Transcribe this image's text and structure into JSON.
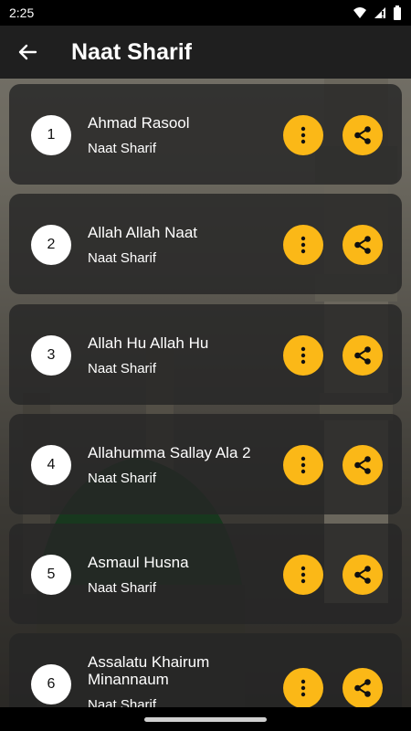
{
  "status_bar": {
    "time": "2:25"
  },
  "app_bar": {
    "title": "Naat Sharif",
    "back_icon": "arrow-left-icon"
  },
  "items": [
    {
      "number": "1",
      "title": "Ahmad Rasool",
      "subtitle": "Naat Sharif"
    },
    {
      "number": "2",
      "title": "Allah Allah Naat",
      "subtitle": "Naat Sharif"
    },
    {
      "number": "3",
      "title": "Allah Hu Allah Hu",
      "subtitle": "Naat Sharif"
    },
    {
      "number": "4",
      "title": "Allahumma Sallay Ala 2",
      "subtitle": "Naat Sharif"
    },
    {
      "number": "5",
      "title": "Asmaul Husna",
      "subtitle": "Naat Sharif"
    },
    {
      "number": "6",
      "title": "Assalatu Khairum Minannaum",
      "subtitle": "Naat Sharif"
    }
  ],
  "colors": {
    "accent": "#fbb817",
    "app_bar": "#1f1f1f",
    "card": "#262626"
  }
}
